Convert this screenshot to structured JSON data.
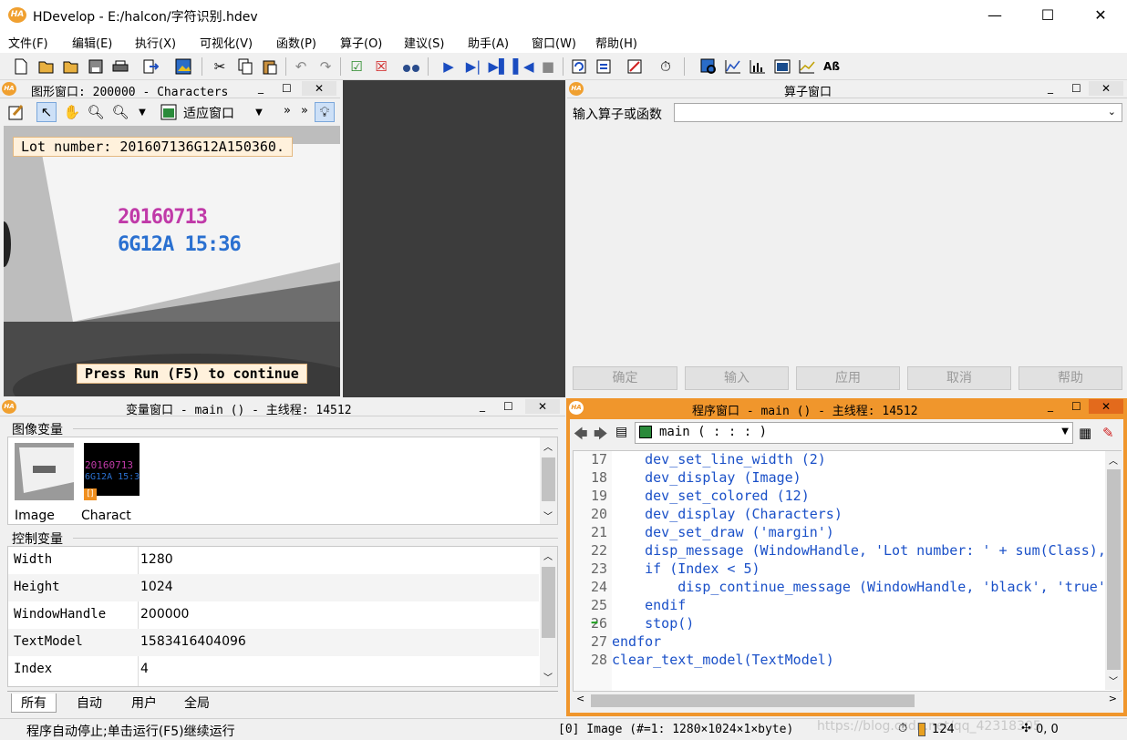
{
  "window": {
    "title": "HDevelop - E:/halcon/字符识别.hdev",
    "app_icon": "HA",
    "min": "—",
    "max": "☐",
    "close": "✕"
  },
  "menu": [
    "文件(F)",
    "编辑(E)",
    "执行(X)",
    "可视化(V)",
    "函数(P)",
    "算子(O)",
    "建议(S)",
    "助手(A)",
    "窗口(W)",
    "帮助(H)"
  ],
  "graphics_window": {
    "title": "图形窗口: 200000 - Characters",
    "fit_label": "适应窗口",
    "message": "Lot number: 201607136G12A150360.",
    "continue": "Press Run (F5) to continue",
    "ocr_line1": "20160713",
    "ocr_line2": "6G12A 15:36"
  },
  "operator_window": {
    "title": "算子窗口",
    "input_label": "输入算子或函数",
    "buttons": [
      "确定",
      "输入",
      "应用",
      "取消",
      "帮助"
    ]
  },
  "variable_window": {
    "title": "变量窗口 - main () - 主线程: 14512",
    "image_section": "图像变量",
    "images": [
      {
        "name": "Image"
      },
      {
        "name": "Charact"
      }
    ],
    "control_section": "控制变量",
    "controls": [
      {
        "name": "Width",
        "value": "1280"
      },
      {
        "name": "Height",
        "value": "1024"
      },
      {
        "name": "WindowHandle",
        "value": "200000"
      },
      {
        "name": "TextModel",
        "value": "1583416404096"
      },
      {
        "name": "Index",
        "value": "4"
      }
    ],
    "tabs": [
      "所有",
      "自动",
      "用户",
      "全局"
    ]
  },
  "program_window": {
    "title": "程序窗口 - main () - 主线程: 14512",
    "procedure": "main ( : : : )",
    "lines": [
      {
        "n": "17",
        "code": "    dev_set_line_width (2)"
      },
      {
        "n": "18",
        "code": "    dev_display (Image)"
      },
      {
        "n": "19",
        "code": "    dev_set_colored (12)"
      },
      {
        "n": "20",
        "code": "    dev_display (Characters)"
      },
      {
        "n": "21",
        "code": "    dev_set_draw ('margin')"
      },
      {
        "n": "22",
        "code": "    disp_message (WindowHandle, 'Lot number: ' + sum(Class),"
      },
      {
        "n": "23",
        "code": "    if (Index < 5)"
      },
      {
        "n": "24",
        "code": "        disp_continue_message (WindowHandle, 'black', 'true'"
      },
      {
        "n": "25",
        "code": "    endif"
      },
      {
        "n": "26",
        "code": "    stop()"
      },
      {
        "n": "27",
        "code": "endfor"
      },
      {
        "n": "28",
        "code": "clear_text_model(TextModel)"
      }
    ]
  },
  "statusbar": {
    "message": "程序自动停止;单击运行(F5)继续运行",
    "image_info": "[0] Image (#=1: 1280×1024×1×byte)",
    "count": "124",
    "coords": "0, 0",
    "watermark": "https://blog.csdn.net/qq_42318305"
  },
  "colors": {
    "accent": "#f0962c",
    "code": "#1a50c8",
    "dark_pane": "#3c3c3c"
  }
}
